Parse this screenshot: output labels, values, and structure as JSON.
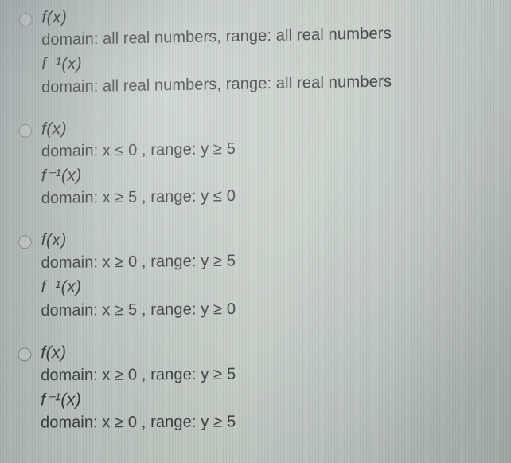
{
  "options": [
    {
      "fx": "f(x)",
      "fx_line": "domain: all real numbers, range: all real numbers",
      "fix": "f⁻¹(x)",
      "fix_line": "domain: all real numbers, range: all real numbers"
    },
    {
      "fx": "f(x)",
      "fx_line": "domain:  x ≤ 0 , range:  y ≥ 5",
      "fix": "f⁻¹(x)",
      "fix_line": "domain:  x ≥ 5 , range:  y ≤ 0"
    },
    {
      "fx": "f(x)",
      "fx_line": "domain:  x ≥ 0 , range:  y ≥ 5",
      "fix": "f⁻¹(x)",
      "fix_line": "domain:  x ≥ 5 , range:  y ≥ 0"
    },
    {
      "fx": "f(x)",
      "fx_line": "domain:  x ≥ 0 , range:  y ≥ 5",
      "fix": "f⁻¹(x)",
      "fix_line": "domain:  x ≥ 0 , range:  y ≥ 5"
    }
  ]
}
